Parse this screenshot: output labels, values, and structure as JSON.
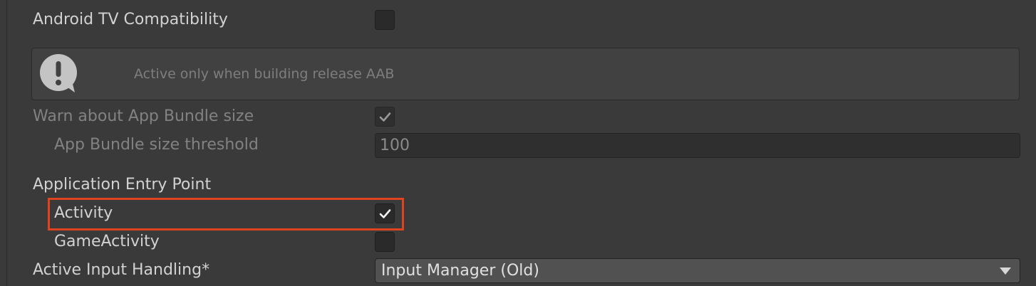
{
  "settings": {
    "android_tv_label": "Android TV Compatibility",
    "android_tv_checked": false,
    "info_message": "Active only when building release AAB",
    "warn_bundle_label": "Warn about App Bundle size",
    "warn_bundle_checked": true,
    "threshold_label": "App Bundle size threshold",
    "threshold_value": "100",
    "entry_point_header": "Application Entry Point",
    "activity_label": "Activity",
    "activity_checked": true,
    "game_activity_label": "GameActivity",
    "game_activity_checked": false,
    "input_handling_label": "Active Input Handling*",
    "input_handling_value": "Input Manager (Old)"
  },
  "icons": {
    "info": "exclamation-speech-bubble-icon",
    "checkmark": "checkmark-icon",
    "dropdown": "triangle-down-icon"
  },
  "colors": {
    "highlight": "#e0431f",
    "background": "#3a3a3a"
  }
}
